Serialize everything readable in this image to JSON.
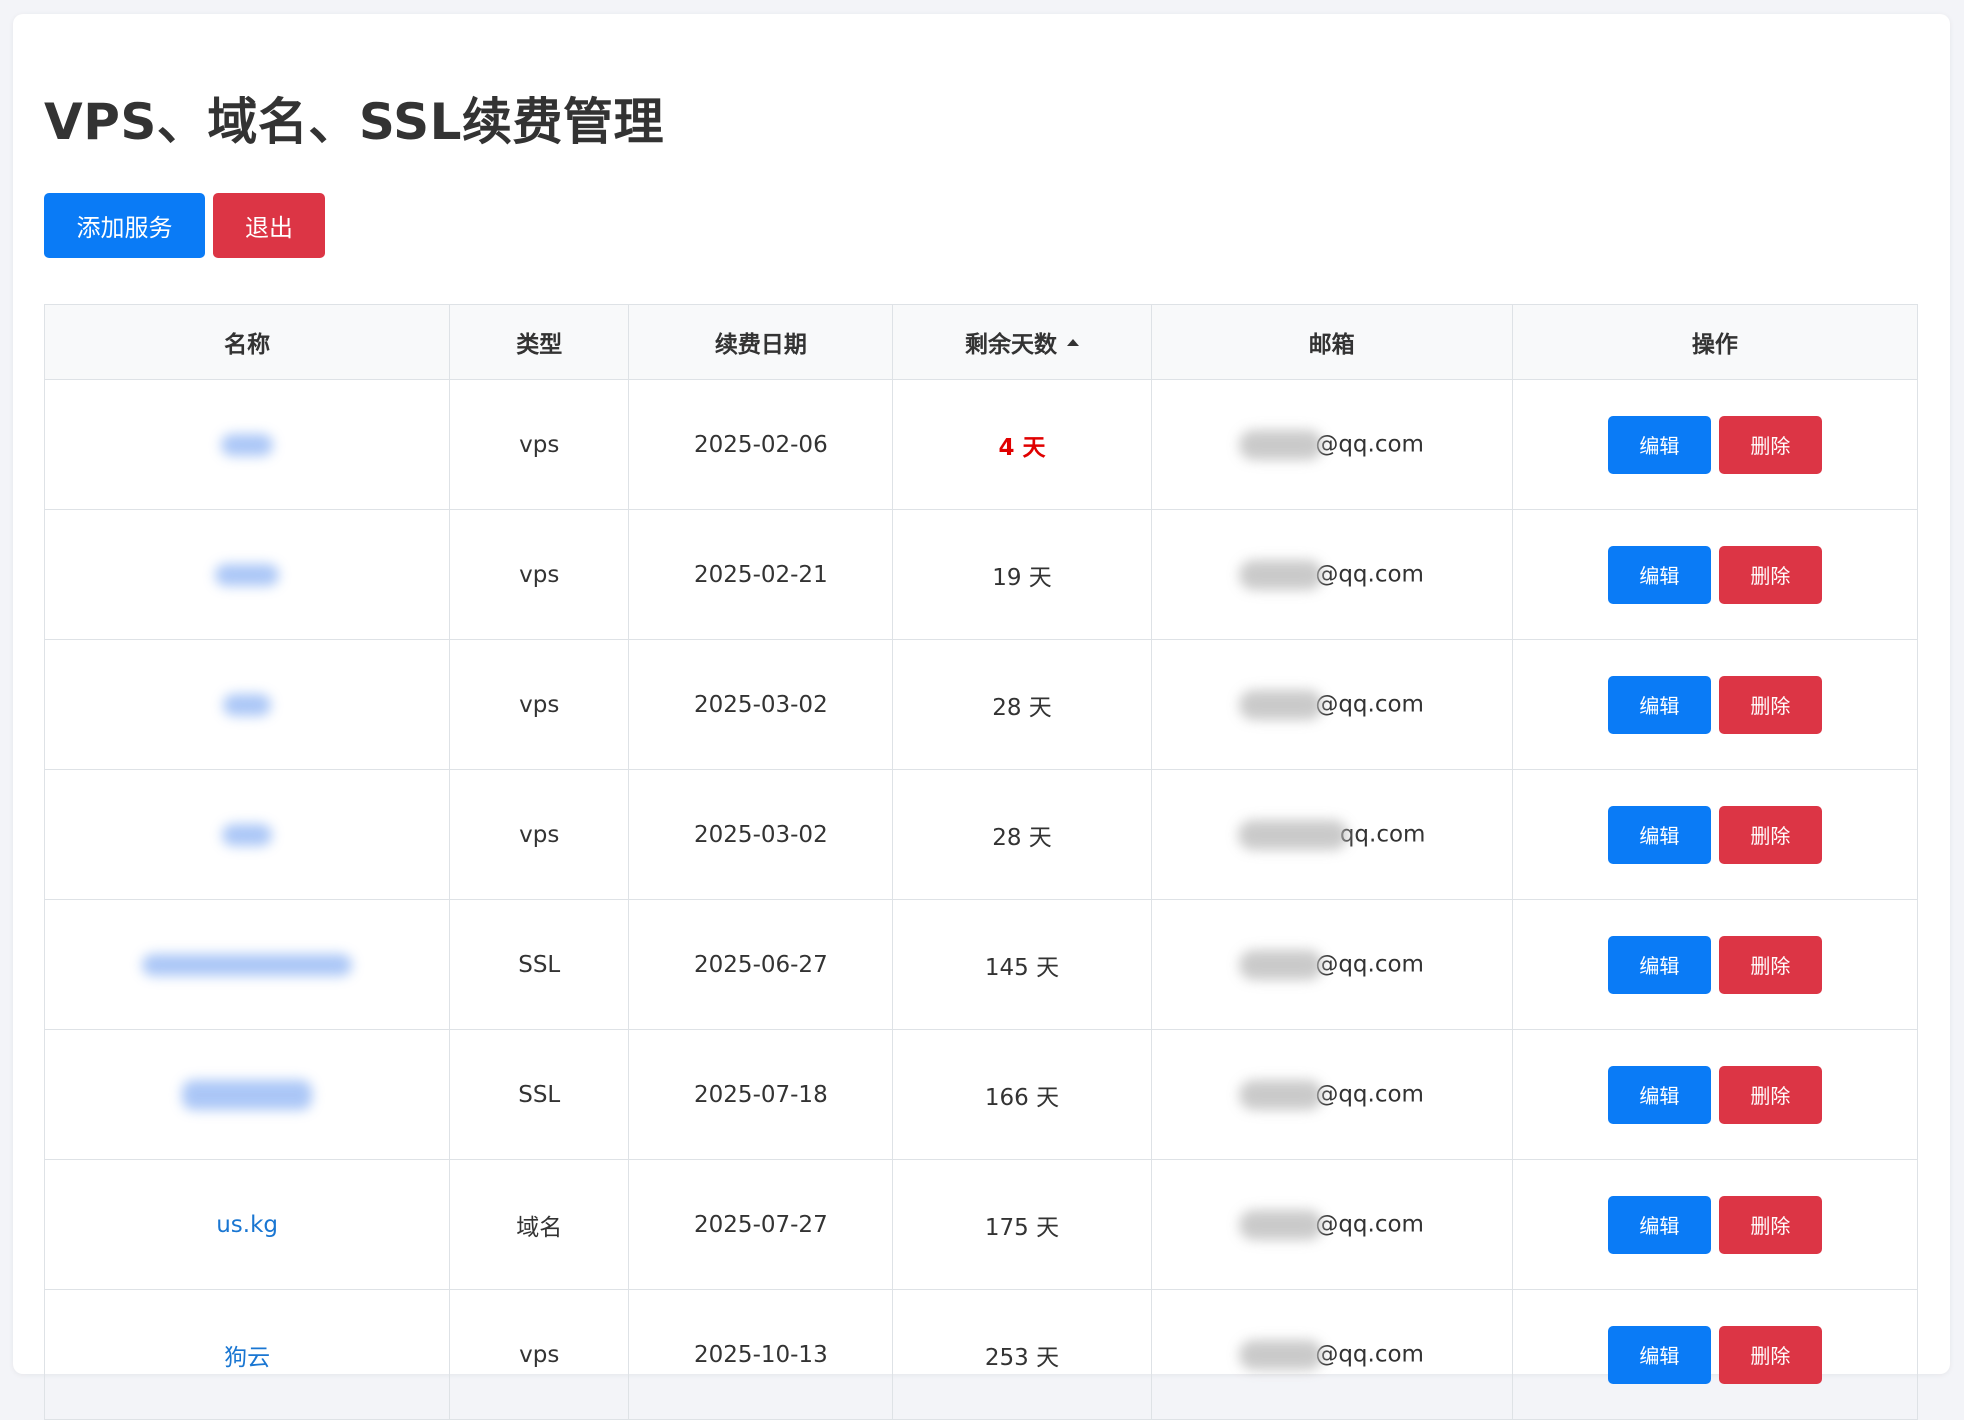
{
  "title": "VPS、域名、SSL续费管理",
  "toolbar": {
    "add_label": "添加服务",
    "logout_label": "退出"
  },
  "table": {
    "headers": {
      "name": "名称",
      "type": "类型",
      "renew_date": "续费日期",
      "days_left": "剩余天数",
      "email": "邮箱",
      "actions": "操作"
    },
    "rows": [
      {
        "name": "",
        "type": "vps",
        "renew_date": "2025-02-06",
        "days_left": "4 天",
        "email_suffix": "@qq.com",
        "urgent": true
      },
      {
        "name": "",
        "type": "vps",
        "renew_date": "2025-02-21",
        "days_left": "19 天",
        "email_suffix": "@qq.com"
      },
      {
        "name": "",
        "type": "vps",
        "renew_date": "2025-03-02",
        "days_left": "28 天",
        "email_suffix": "@qq.com"
      },
      {
        "name": "",
        "type": "vps",
        "renew_date": "2025-03-02",
        "days_left": "28 天",
        "email_suffix": "qq.com"
      },
      {
        "name": "",
        "type": "SSL",
        "renew_date": "2025-06-27",
        "days_left": "145 天",
        "email_suffix": "@qq.com"
      },
      {
        "name": "",
        "type": "SSL",
        "renew_date": "2025-07-18",
        "days_left": "166 天",
        "email_suffix": "@qq.com"
      },
      {
        "name": "us.kg",
        "type": "域名",
        "renew_date": "2025-07-27",
        "days_left": "175 天",
        "email_suffix": "@qq.com"
      },
      {
        "name": "狗云",
        "type": "vps",
        "renew_date": "2025-10-13",
        "days_left": "253 天",
        "email_suffix": "@qq.com"
      }
    ],
    "edit_label": "编辑",
    "delete_label": "删除"
  },
  "colors": {
    "primary": "#0a7bf6",
    "danger": "#dc3545",
    "link": "#1976d2",
    "urgent": "#e00000"
  }
}
